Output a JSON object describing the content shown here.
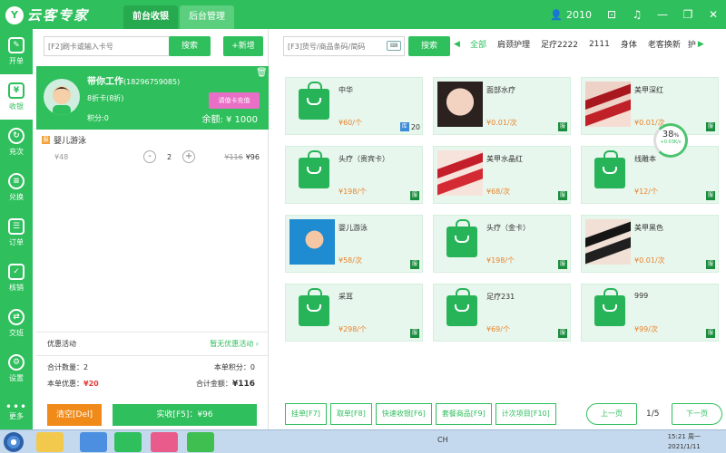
{
  "app": {
    "logo_text": "云客专家",
    "logo_mark": "Y"
  },
  "top_tabs": [
    {
      "label": "前台收银",
      "active": true
    },
    {
      "label": "后台管理",
      "active": false
    }
  ],
  "user": {
    "name": "2010",
    "icon": "user-icon"
  },
  "window_controls": [
    "lock-icon",
    "bell-icon",
    "minimize-icon",
    "restore-icon",
    "close-icon"
  ],
  "nav": [
    {
      "label": "开单",
      "icon": "edit-icon",
      "glyph": "✎",
      "active": false
    },
    {
      "label": "收银",
      "icon": "cashier-icon",
      "glyph": "¥",
      "active": true
    },
    {
      "label": "充次",
      "icon": "recharge-icon",
      "glyph": "↻",
      "active": false
    },
    {
      "label": "兑换",
      "icon": "database-icon",
      "glyph": "≡",
      "active": false
    },
    {
      "label": "订单",
      "icon": "order-icon",
      "glyph": "☰",
      "active": false
    },
    {
      "label": "核销",
      "icon": "ticket-icon",
      "glyph": "✓",
      "active": false
    },
    {
      "label": "交班",
      "icon": "shift-icon",
      "glyph": "⇄",
      "active": false
    },
    {
      "label": "设置",
      "icon": "gear-icon",
      "glyph": "⚙",
      "active": false
    }
  ],
  "nav_more": {
    "label": "更多",
    "icon": "more-dots-icon"
  },
  "left": {
    "card_search_placeholder": "[F2]刷卡或输入卡号",
    "search_label": "搜索",
    "new_label": "+新增",
    "member": {
      "name": "带你工作",
      "phone": "(18296759085)",
      "card": "8折卡(8折)",
      "points": "积分:0",
      "recharge_label": "请值卡充值",
      "balance": "余额: ¥ 1000"
    },
    "item": {
      "badge": "服",
      "name": "婴儿游泳",
      "price": "¥48",
      "qty": "2",
      "original_total": "¥116",
      "total": "¥96"
    },
    "promo_label": "优惠活动",
    "promo_value": "暂无优惠活动",
    "count_label": "合计数量：2",
    "points_label": "本单积分：0",
    "discount_label": "本单优惠：",
    "discount_value": "¥20",
    "amount_label": "合计金额：",
    "amount_value": "¥116",
    "clear_label": "清空[Del]",
    "pay_label": "实收[F5]：¥96"
  },
  "right": {
    "goods_search_placeholder": "[F3]货号/商品条码/简码",
    "search_label": "搜索",
    "categories": [
      "全部",
      "肩颈护理",
      "足疗2222",
      "2111",
      "身体",
      "老客换新",
      "护"
    ],
    "goods": [
      {
        "name": "中华",
        "price": "¥60/个",
        "img": "bag",
        "tag": "库",
        "stock": "20"
      },
      {
        "name": "面部水疗",
        "price": "¥0.01/次",
        "img": "face",
        "tag": "服"
      },
      {
        "name": "美甲深红",
        "price": "¥0.01/次",
        "img": "nail",
        "tag": "服"
      },
      {
        "name": "头疗（贵宾卡）",
        "price": "¥198/个",
        "img": "bag",
        "tag": "服"
      },
      {
        "name": "美甲水晶红",
        "price": "¥68/次",
        "img": "nail2",
        "tag": "服"
      },
      {
        "name": "线雕本",
        "price": "¥12/个",
        "img": "bag",
        "tag": "服"
      },
      {
        "name": "婴儿游泳",
        "price": "¥58/次",
        "img": "swim",
        "tag": "服"
      },
      {
        "name": "头疗（金卡）",
        "price": "¥198/个",
        "img": "bag",
        "tag": "服"
      },
      {
        "name": "美甲黑色",
        "price": "¥0.01/次",
        "img": "black",
        "tag": "服"
      },
      {
        "name": "采耳",
        "price": "¥298/个",
        "img": "bag",
        "tag": "服"
      },
      {
        "name": "足疗231",
        "price": "¥69/个",
        "img": "bag",
        "tag": "服"
      },
      {
        "name": "999",
        "price": "¥99/次",
        "img": "bag",
        "tag": "服"
      }
    ],
    "gauge": {
      "percent": "38",
      "percent_sign": "%",
      "speed": "+0.03K/s"
    },
    "bottom_buttons": [
      "挂单[F7]",
      "取单[F8]",
      "快速收银[F6]",
      "套餐商品[F9]",
      "计次项目[F10]"
    ],
    "prev_label": "上一页",
    "page": "1/5",
    "next_label": "下一页"
  },
  "taskbar": {
    "time": "15:21 周一",
    "date": "2021/1/11",
    "tray_text": "CH"
  }
}
